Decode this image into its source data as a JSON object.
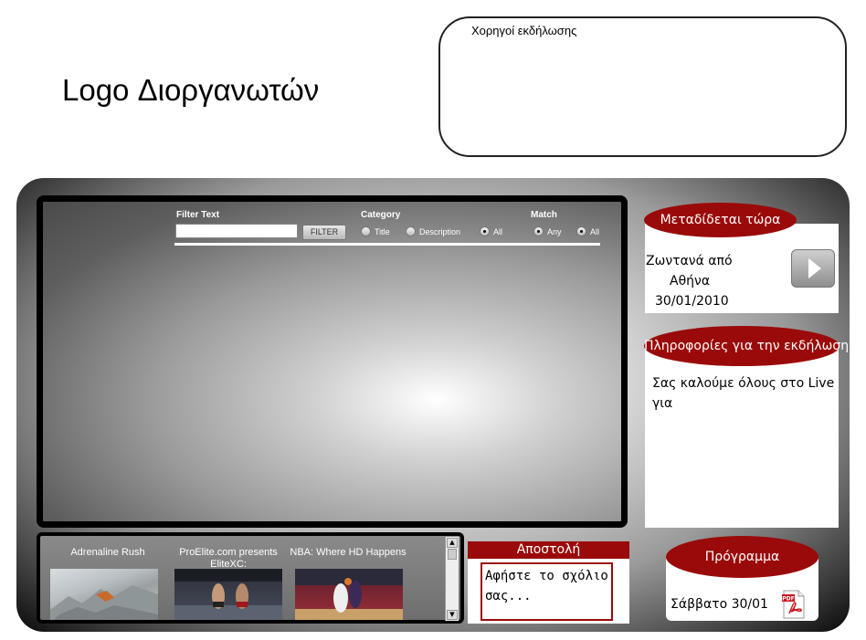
{
  "header": {
    "logo_text": "Logo Διοργανωτών",
    "sponsors_title": "Χορηγοί εκδήλωσης"
  },
  "player": {
    "filter_text_label": "Filter Text",
    "filter_button": "FILTER",
    "category_label": "Category",
    "category_options": [
      "Title",
      "Description",
      "All"
    ],
    "category_selected": "All",
    "match_label": "Match",
    "match_options": [
      "Any",
      "All"
    ],
    "match_selected": "Any"
  },
  "playlist": {
    "items": [
      {
        "title": "Adrenaline Rush"
      },
      {
        "title": "ProElite.com presents EliteXC:"
      },
      {
        "title": "NBA: Where HD Happens"
      }
    ]
  },
  "comment": {
    "header": "Αποστολή",
    "placeholder": "Αφήστε το σχόλιο σας..."
  },
  "live_now": {
    "title": "Μεταδίδεται τώρα",
    "line1": "Ζωντανά από",
    "line2": "Αθήνα",
    "line3": "30/01/2010"
  },
  "event_info": {
    "title": "Πληροφορίες για την εκδήλωση",
    "text": "Σας καλούμε όλους στο Live για"
  },
  "program": {
    "title": "Πρόγραμμα",
    "date": "Σάββατο 30/01",
    "pdf_icon_text": "PDF"
  },
  "colors": {
    "accent": "#9b0a0a"
  }
}
